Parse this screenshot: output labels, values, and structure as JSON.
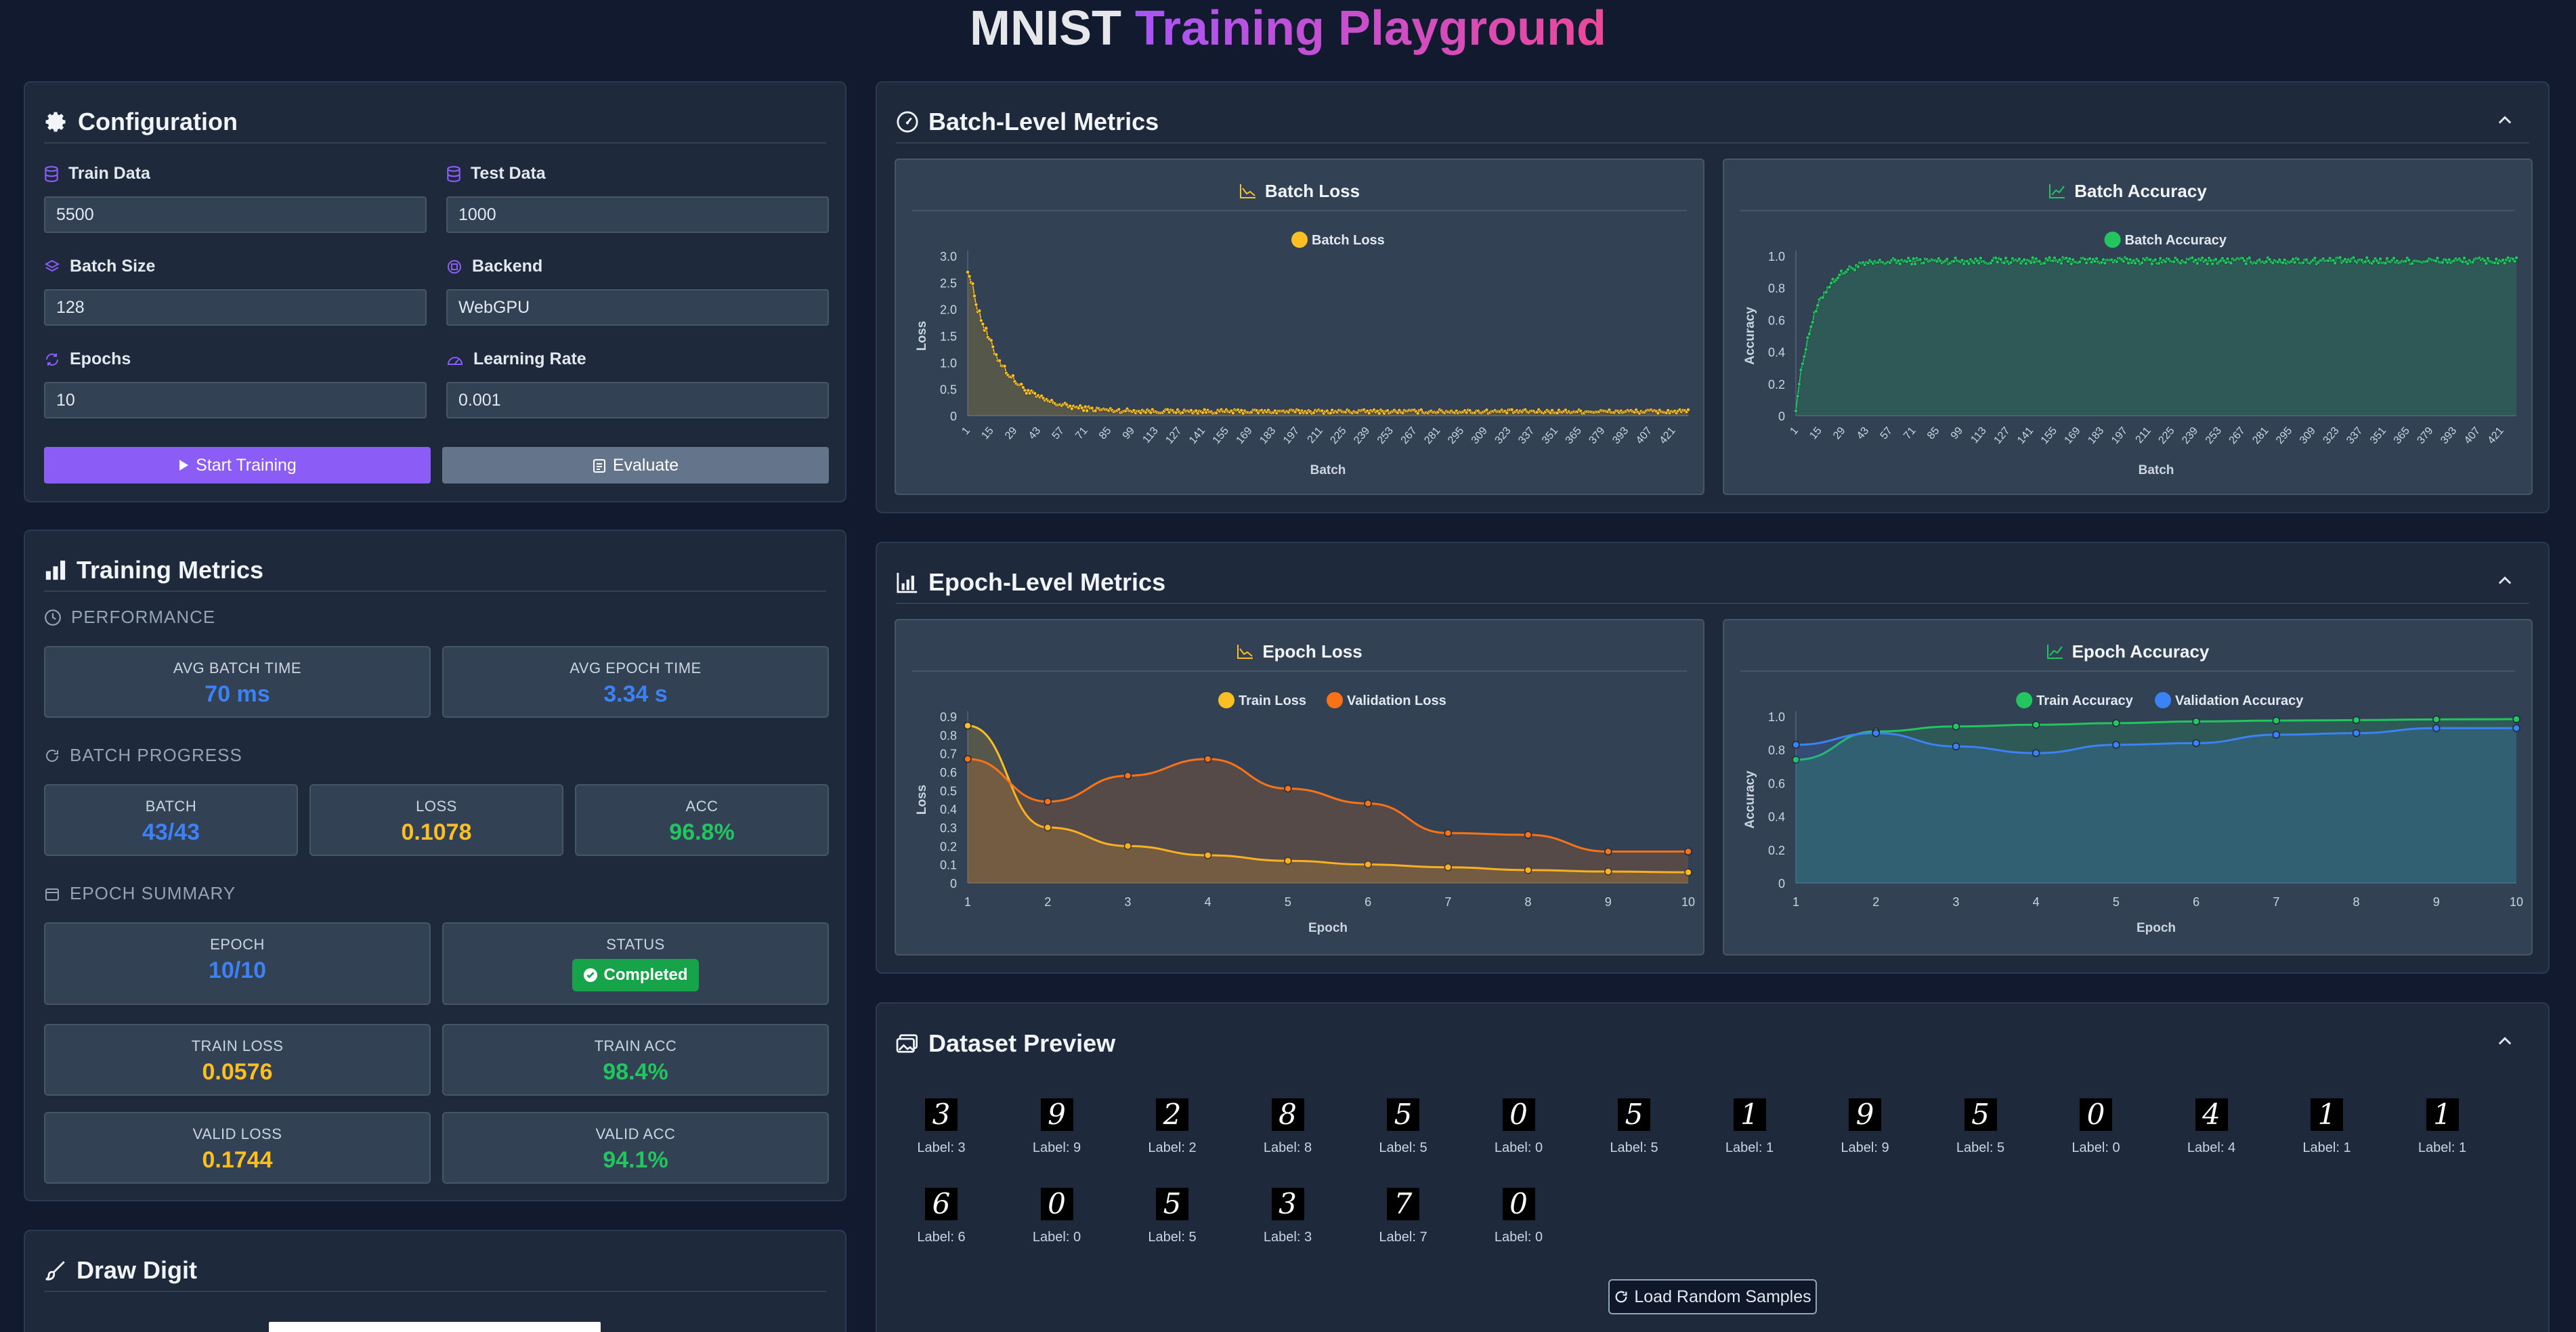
{
  "title": {
    "part1": "MNIST",
    "part2": "Training Playground"
  },
  "config": {
    "heading": "Configuration",
    "fields": [
      {
        "label": "Train Data",
        "value": "5500"
      },
      {
        "label": "Test Data",
        "value": "1000"
      },
      {
        "label": "Batch Size",
        "value": "128"
      },
      {
        "label": "Backend",
        "value": "WebGPU"
      },
      {
        "label": "Epochs",
        "value": "10"
      },
      {
        "label": "Learning Rate",
        "value": "0.001"
      }
    ],
    "start_label": "Start Training",
    "evaluate_label": "Evaluate"
  },
  "metrics": {
    "heading": "Training Metrics",
    "performance_label": "PERFORMANCE",
    "avg_batch_time_label": "AVG BATCH TIME",
    "avg_batch_time": "70 ms",
    "avg_epoch_time_label": "AVG EPOCH TIME",
    "avg_epoch_time": "3.34 s",
    "batch_progress_label": "BATCH PROGRESS",
    "batch_label": "BATCH",
    "batch_value": "43/43",
    "loss_label": "LOSS",
    "loss_value": "0.1078",
    "acc_label": "ACC",
    "acc_value": "96.8%",
    "epoch_summary_label": "EPOCH SUMMARY",
    "epoch_label": "EPOCH",
    "epoch_value": "10/10",
    "status_label": "STATUS",
    "status_value": "Completed",
    "train_loss_label": "TRAIN LOSS",
    "train_loss": "0.0576",
    "train_acc_label": "TRAIN ACC",
    "train_acc": "98.4%",
    "valid_loss_label": "VALID LOSS",
    "valid_loss": "0.1744",
    "valid_acc_label": "VALID ACC",
    "valid_acc": "94.1%"
  },
  "draw": {
    "heading": "Draw Digit"
  },
  "batch_panel": {
    "heading": "Batch-Level Metrics"
  },
  "epoch_panel": {
    "heading": "Epoch-Level Metrics"
  },
  "dataset": {
    "heading": "Dataset Preview",
    "load_label": "Load Random Samples",
    "samples": [
      {
        "digit": "3",
        "label": "Label: 3"
      },
      {
        "digit": "9",
        "label": "Label: 9"
      },
      {
        "digit": "2",
        "label": "Label: 2"
      },
      {
        "digit": "8",
        "label": "Label: 8"
      },
      {
        "digit": "5",
        "label": "Label: 5"
      },
      {
        "digit": "0",
        "label": "Label: 0"
      },
      {
        "digit": "5",
        "label": "Label: 5"
      },
      {
        "digit": "1",
        "label": "Label: 1"
      },
      {
        "digit": "9",
        "label": "Label: 9"
      },
      {
        "digit": "5",
        "label": "Label: 5"
      },
      {
        "digit": "0",
        "label": "Label: 0"
      },
      {
        "digit": "4",
        "label": "Label: 4"
      },
      {
        "digit": "1",
        "label": "Label: 1"
      },
      {
        "digit": "1",
        "label": "Label: 1"
      },
      {
        "digit": "6",
        "label": "Label: 6"
      },
      {
        "digit": "0",
        "label": "Label: 0"
      },
      {
        "digit": "5",
        "label": "Label: 5"
      },
      {
        "digit": "3",
        "label": "Label: 3"
      },
      {
        "digit": "7",
        "label": "Label: 7"
      },
      {
        "digit": "0",
        "label": "Label: 0"
      }
    ]
  },
  "colors": {
    "accent": "#8b5cf6",
    "loss": "#fbbf24",
    "val_loss": "#f97316",
    "train_acc": "#22c55e",
    "val_acc": "#3b82f6"
  },
  "chart_data": [
    {
      "type": "line",
      "title": "Batch Loss",
      "xlabel": "Batch",
      "ylabel": "Loss",
      "ylim": [
        0,
        3.0
      ],
      "yticks": [
        "0",
        "0.5",
        "1.0",
        "1.5",
        "2.0",
        "2.5",
        "3.0"
      ],
      "xticks": [
        "1",
        "15",
        "29",
        "43",
        "57",
        "71",
        "85",
        "99",
        "113",
        "127",
        "141",
        "155",
        "169",
        "183",
        "197",
        "211",
        "225",
        "239",
        "253",
        "267",
        "281",
        "295",
        "309",
        "323",
        "337",
        "351",
        "365",
        "379",
        "393",
        "407",
        "421"
      ],
      "xmax": 430,
      "series": [
        {
          "name": "Batch Loss",
          "color": "#fbbf24",
          "decay": {
            "start": 2.8,
            "floor": 0.08,
            "rate": 0.055,
            "noise": 0.035
          }
        }
      ]
    },
    {
      "type": "line",
      "title": "Batch Accuracy",
      "xlabel": "Batch",
      "ylabel": "Accuracy",
      "ylim": [
        0,
        1.0
      ],
      "yticks": [
        "0",
        "0.2",
        "0.4",
        "0.6",
        "0.8",
        "1.0"
      ],
      "xticks": [
        "1",
        "15",
        "29",
        "43",
        "57",
        "71",
        "85",
        "99",
        "113",
        "127",
        "141",
        "155",
        "169",
        "183",
        "197",
        "211",
        "225",
        "239",
        "253",
        "267",
        "281",
        "295",
        "309",
        "323",
        "337",
        "351",
        "365",
        "379",
        "393",
        "407",
        "421"
      ],
      "xmax": 430,
      "series": [
        {
          "name": "Batch Accuracy",
          "color": "#22c55e",
          "rise": {
            "start": 0.05,
            "ceiling": 0.97,
            "rate": 0.09,
            "noise": 0.02
          }
        }
      ]
    },
    {
      "type": "line",
      "title": "Epoch Loss",
      "xlabel": "Epoch",
      "ylabel": "Loss",
      "ylim": [
        0,
        0.9
      ],
      "yticks": [
        "0",
        "0.1",
        "0.2",
        "0.3",
        "0.4",
        "0.5",
        "0.6",
        "0.7",
        "0.8",
        "0.9"
      ],
      "x": [
        1,
        2,
        3,
        4,
        5,
        6,
        7,
        8,
        9,
        10
      ],
      "series": [
        {
          "name": "Train Loss",
          "color": "#fbbf24",
          "values": [
            0.85,
            0.3,
            0.2,
            0.15,
            0.12,
            0.1,
            0.085,
            0.07,
            0.062,
            0.058
          ]
        },
        {
          "name": "Validation Loss",
          "color": "#f97316",
          "values": [
            0.67,
            0.44,
            0.58,
            0.67,
            0.51,
            0.43,
            0.27,
            0.26,
            0.17,
            0.17
          ]
        }
      ]
    },
    {
      "type": "line",
      "title": "Epoch Accuracy",
      "xlabel": "Epoch",
      "ylabel": "Accuracy",
      "ylim": [
        0,
        1.0
      ],
      "yticks": [
        "0",
        "0.2",
        "0.4",
        "0.6",
        "0.8",
        "1.0"
      ],
      "x": [
        1,
        2,
        3,
        4,
        5,
        6,
        7,
        8,
        9,
        10
      ],
      "series": [
        {
          "name": "Train Accuracy",
          "color": "#22c55e",
          "values": [
            0.74,
            0.91,
            0.94,
            0.95,
            0.96,
            0.97,
            0.975,
            0.978,
            0.982,
            0.984
          ]
        },
        {
          "name": "Validation Accuracy",
          "color": "#3b82f6",
          "values": [
            0.83,
            0.9,
            0.82,
            0.78,
            0.83,
            0.84,
            0.89,
            0.9,
            0.93,
            0.93
          ]
        }
      ]
    }
  ]
}
